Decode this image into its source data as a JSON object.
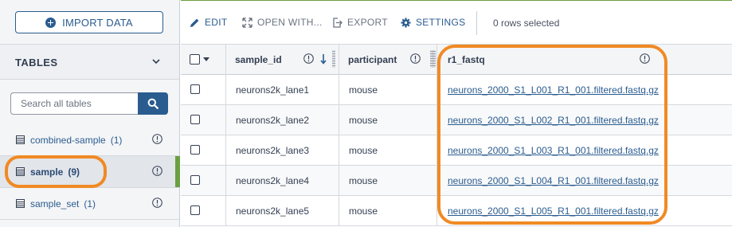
{
  "sidebar": {
    "import_label": "IMPORT DATA",
    "tables_title": "TABLES",
    "search": {
      "placeholder": "Search all tables"
    },
    "items": [
      {
        "name": "combined-sample",
        "count": "(1)"
      },
      {
        "name": "sample",
        "count": "(9)",
        "active": true
      },
      {
        "name": "sample_set",
        "count": "(1)"
      }
    ]
  },
  "toolbar": {
    "edit_label": "EDIT",
    "open_with_label": "OPEN WITH...",
    "export_label": "EXPORT",
    "settings_label": "SETTINGS",
    "rows_selected": "0 rows selected"
  },
  "table": {
    "columns": [
      "sample_id",
      "participant",
      "r1_fastq"
    ],
    "rows": [
      {
        "sample_id": "neurons2k_lane1",
        "participant": "mouse",
        "r1_fastq": "neurons_2000_S1_L001_R1_001.filtered.fastq.gz"
      },
      {
        "sample_id": "neurons2k_lane2",
        "participant": "mouse",
        "r1_fastq": "neurons_2000_S1_L002_R1_001.filtered.fastq.gz"
      },
      {
        "sample_id": "neurons2k_lane3",
        "participant": "mouse",
        "r1_fastq": "neurons_2000_S1_L003_R1_001.filtered.fastq.gz"
      },
      {
        "sample_id": "neurons2k_lane4",
        "participant": "mouse",
        "r1_fastq": "neurons_2000_S1_L004_R1_001.filtered.fastq.gz"
      },
      {
        "sample_id": "neurons2k_lane5",
        "participant": "mouse",
        "r1_fastq": "neurons_2000_S1_L005_R1_001.filtered.fastq.gz"
      }
    ]
  },
  "colors": {
    "accent": "#2b5c8f",
    "active_bar": "#6aa041",
    "highlight": "#f08a24"
  }
}
